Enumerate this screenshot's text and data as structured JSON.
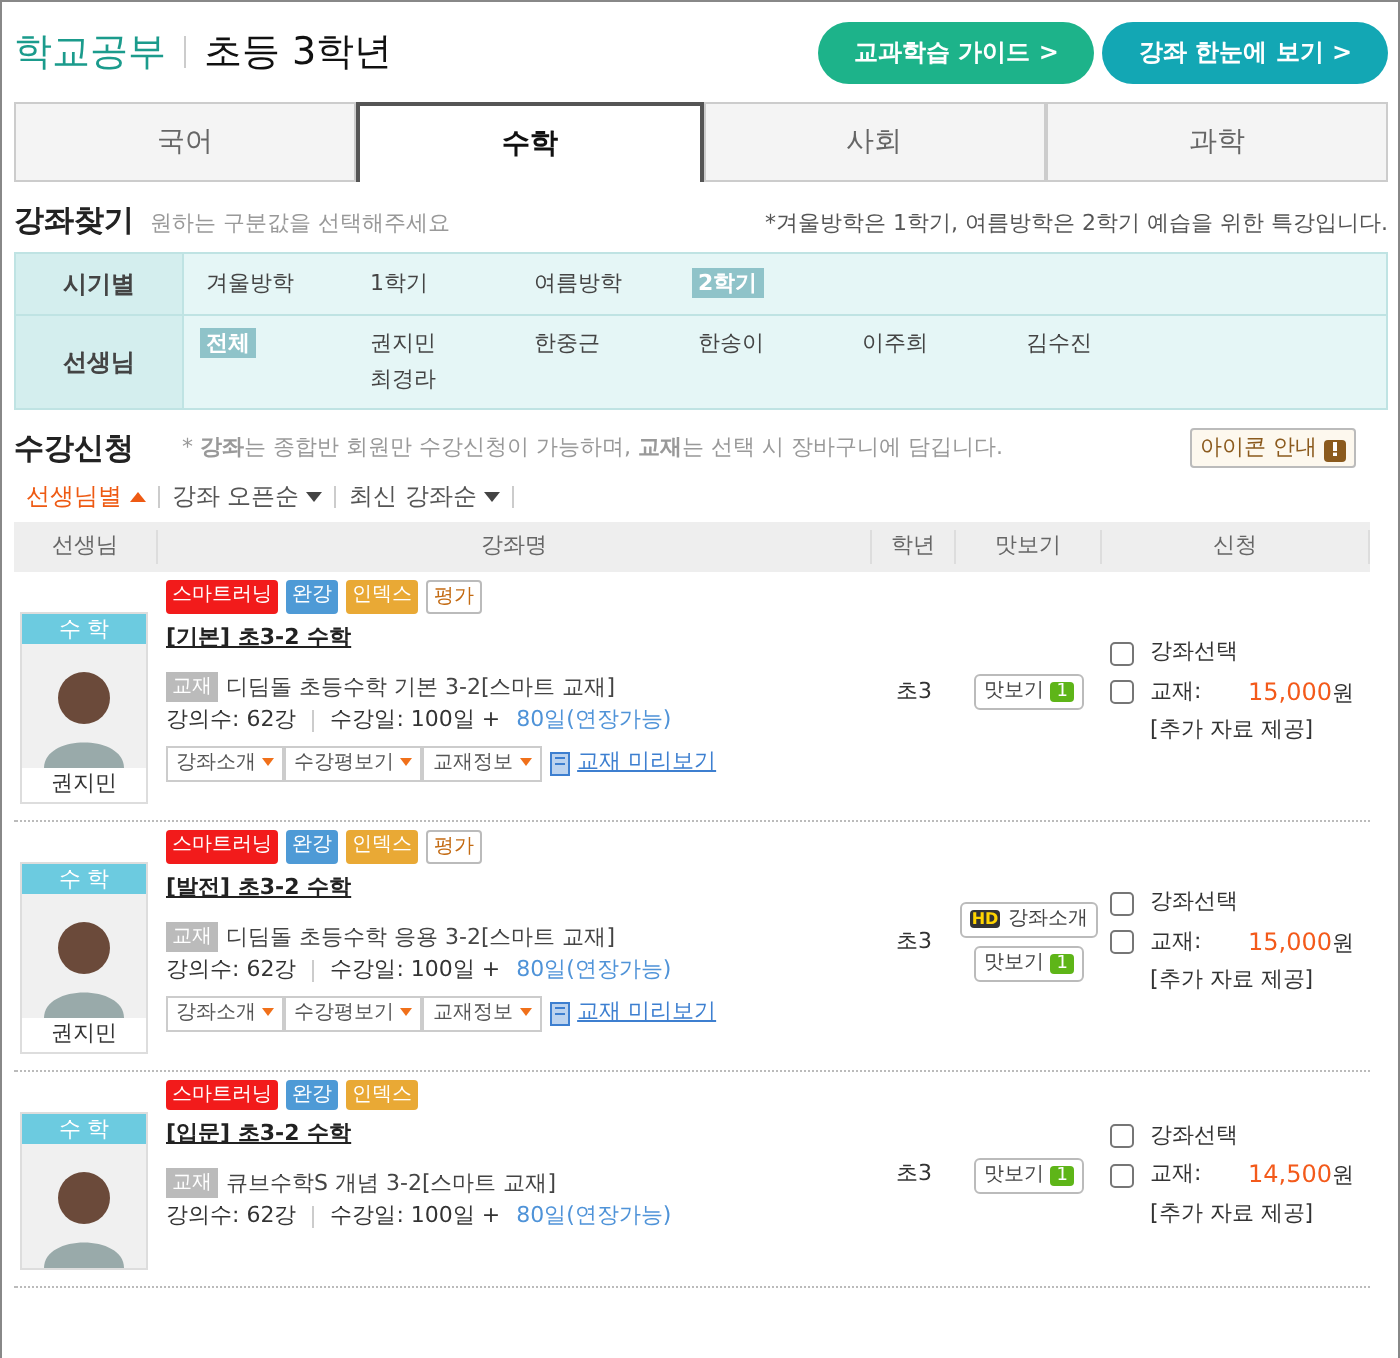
{
  "header": {
    "brand": "학교공부",
    "grade": "초등 3학년",
    "buttons": [
      {
        "label": "교과학습 가이드 >",
        "kind": "green"
      },
      {
        "label": "강좌 한눈에 보기 >",
        "kind": "teal"
      }
    ]
  },
  "tabs": [
    {
      "label": "국어",
      "selected": false
    },
    {
      "label": "수학",
      "selected": true
    },
    {
      "label": "사회",
      "selected": false
    },
    {
      "label": "과학",
      "selected": false
    }
  ],
  "search": {
    "title": "강좌찾기",
    "hint": "원하는 구분값을 선택해주세요",
    "note": "*겨울방학은 1학기, 여름방학은 2학기 예습을 위한 특강입니다.",
    "filters": [
      {
        "label": "시기별",
        "options": [
          {
            "label": "겨울방학",
            "kind": "item",
            "selected": false
          },
          {
            "label": "1학기",
            "kind": "item",
            "selected": false
          },
          {
            "label": "여름방학",
            "kind": "item",
            "selected": false
          },
          {
            "label": "2학기",
            "kind": "item",
            "selected": true
          }
        ]
      },
      {
        "label": "선생님",
        "options": [
          {
            "label": "전체",
            "kind": "all",
            "selected": true
          },
          {
            "label": "권지민",
            "kind": "item",
            "selected": false
          },
          {
            "label": "한중근",
            "kind": "item",
            "selected": false
          },
          {
            "label": "한송이",
            "kind": "item",
            "selected": false
          },
          {
            "label": "이주희",
            "kind": "item",
            "selected": false
          },
          {
            "label": "김수진",
            "kind": "item",
            "selected": false
          },
          {
            "label": "최경라",
            "kind": "item",
            "selected": false
          }
        ]
      }
    ]
  },
  "enroll": {
    "title": "수강신청",
    "note": "* **강좌**는 종합반 회원만 수강신청이 가능하며, **교재**는 선택 시 장바구니에 담깁니다.",
    "icon_guide": "아이콘 안내"
  },
  "sorts": [
    {
      "label": "선생님별",
      "selected": true
    },
    {
      "label": "강좌 오픈순",
      "selected": false
    },
    {
      "label": "최신 강좌순",
      "selected": false
    }
  ],
  "table": {
    "columns": [
      "선생님",
      "강좌명",
      "학년",
      "맛보기",
      "신청"
    ],
    "rows": [
      {
        "subject": "수 학",
        "teacher": "권지민",
        "tags": [
          {
            "label": "스마트러닝",
            "kind": "smart"
          },
          {
            "label": "완강",
            "kind": "done"
          },
          {
            "label": "인덱스",
            "kind": "index"
          },
          {
            "label": "평가",
            "kind": "eval"
          }
        ],
        "title": "[기본] 초3-2 수학",
        "book_tag": "교재",
        "book": "디딤돌 초등수학 기본 3-2[스마트 교재]",
        "count": "강의수: 62강",
        "days": "수강일: 100일 +",
        "extension": "80일(연장가능)",
        "actions": [
          "강좌소개",
          "수강평보기",
          "교재정보"
        ],
        "preview_link": "교재 미리보기",
        "grade": "초3",
        "sample": "맛보기",
        "sample_count": "1",
        "course_label": "강좌선택",
        "course_checked": false,
        "book_label": "교재:",
        "book_checked": false,
        "price": "15,000",
        "unit": "원",
        "extra": "[추가 자료 제공]"
      },
      {
        "subject": "수 학",
        "teacher": "권지민",
        "tags": [
          {
            "label": "스마트러닝",
            "kind": "smart"
          },
          {
            "label": "완강",
            "kind": "done"
          },
          {
            "label": "인덱스",
            "kind": "index"
          },
          {
            "label": "평가",
            "kind": "eval"
          }
        ],
        "title": "[발전] 초3-2 수학",
        "book_tag": "교재",
        "book": "디딤돌 초등수학 응용 3-2[스마트 교재]",
        "count": "강의수: 62강",
        "days": "수강일: 100일 +",
        "extension": "80일(연장가능)",
        "actions": [
          "강좌소개",
          "수강평보기",
          "교재정보"
        ],
        "preview_link": "교재 미리보기",
        "grade": "초3",
        "intro_badge": "HD",
        "intro": "강좌소개",
        "sample": "맛보기",
        "sample_count": "1",
        "course_label": "강좌선택",
        "course_checked": false,
        "book_label": "교재:",
        "book_checked": false,
        "price": "15,000",
        "unit": "원",
        "extra": "[추가 자료 제공]"
      },
      {
        "subject": "수 학",
        "tags": [
          {
            "label": "스마트러닝",
            "kind": "smart"
          },
          {
            "label": "완강",
            "kind": "done"
          },
          {
            "label": "인덱스",
            "kind": "index"
          }
        ],
        "title": "[입문] 초3-2 수학",
        "book_tag": "교재",
        "book": "큐브수학S 개념 3-2[스마트 교재]",
        "count": "강의수: 62강",
        "days": "수강일: 100일 +",
        "extension": "80일(연장가능)",
        "grade": "초3",
        "sample": "맛보기",
        "sample_count": "1",
        "course_label": "강좌선택",
        "course_checked": false,
        "book_label": "교재:",
        "book_checked": false,
        "price": "14,500",
        "unit": "원",
        "extra": "[추가 자료 제공]"
      }
    ]
  }
}
